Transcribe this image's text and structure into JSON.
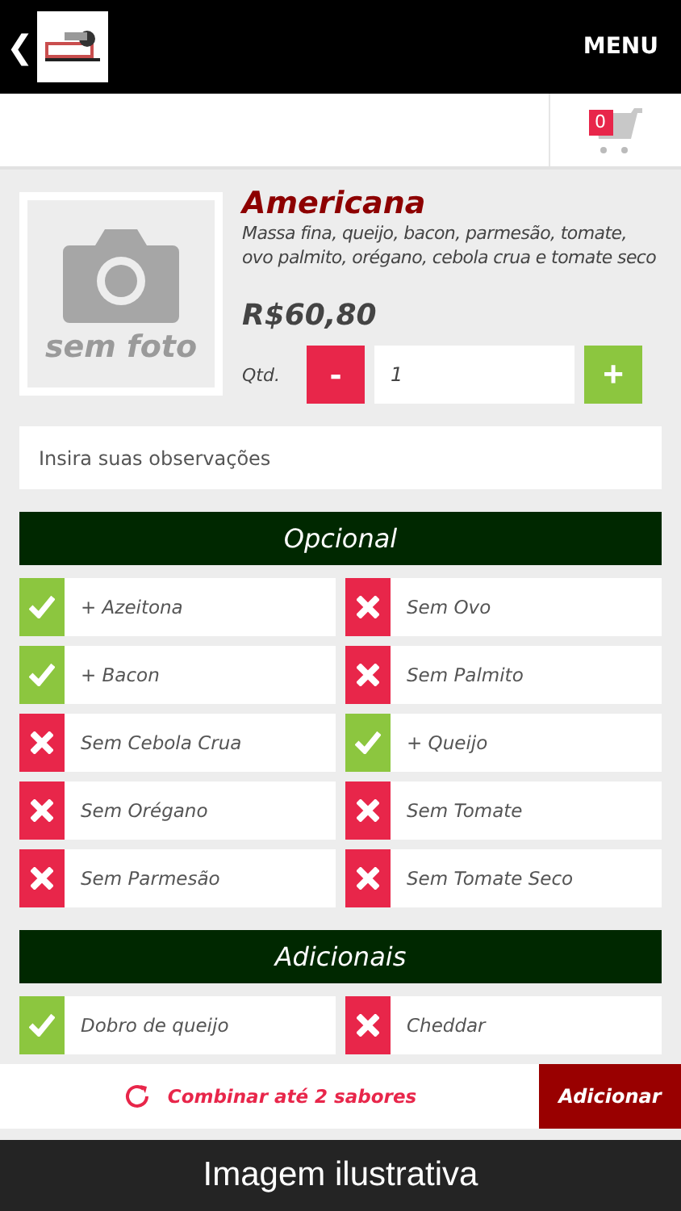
{
  "header": {
    "back": "❮",
    "menu": "MENU"
  },
  "cart": {
    "count": "0"
  },
  "product": {
    "no_photo": "sem foto",
    "name": "Americana",
    "description": "Massa fina, queijo, bacon, parmesão, tomate, ovo palmito, orégano, cebola crua e tomate seco",
    "price": "R$60,80",
    "qty_label": "Qtd.",
    "minus": "-",
    "qty": "1",
    "plus": "+"
  },
  "notes": {
    "placeholder": "Insira suas observações"
  },
  "sections": [
    {
      "title": "Opcional",
      "items": [
        {
          "label": "+ Azeitona",
          "included": true
        },
        {
          "label": "Sem Ovo",
          "included": false
        },
        {
          "label": "+ Bacon",
          "included": true
        },
        {
          "label": "Sem Palmito",
          "included": false
        },
        {
          "label": "Sem Cebola Crua",
          "included": false
        },
        {
          "label": "+ Queijo",
          "included": true
        },
        {
          "label": "Sem Orégano",
          "included": false
        },
        {
          "label": "Sem Tomate",
          "included": false
        },
        {
          "label": "Sem Parmesão",
          "included": false
        },
        {
          "label": "Sem Tomate Seco",
          "included": false
        }
      ]
    },
    {
      "title": "Adicionais",
      "items": [
        {
          "label": "Dobro de queijo",
          "included": true
        },
        {
          "label": "Cheddar",
          "included": false
        }
      ]
    }
  ],
  "footer": {
    "combine": "Combinar até 2 sabores",
    "add": "Adicionar"
  },
  "caption": "Imagem ilustrativa"
}
